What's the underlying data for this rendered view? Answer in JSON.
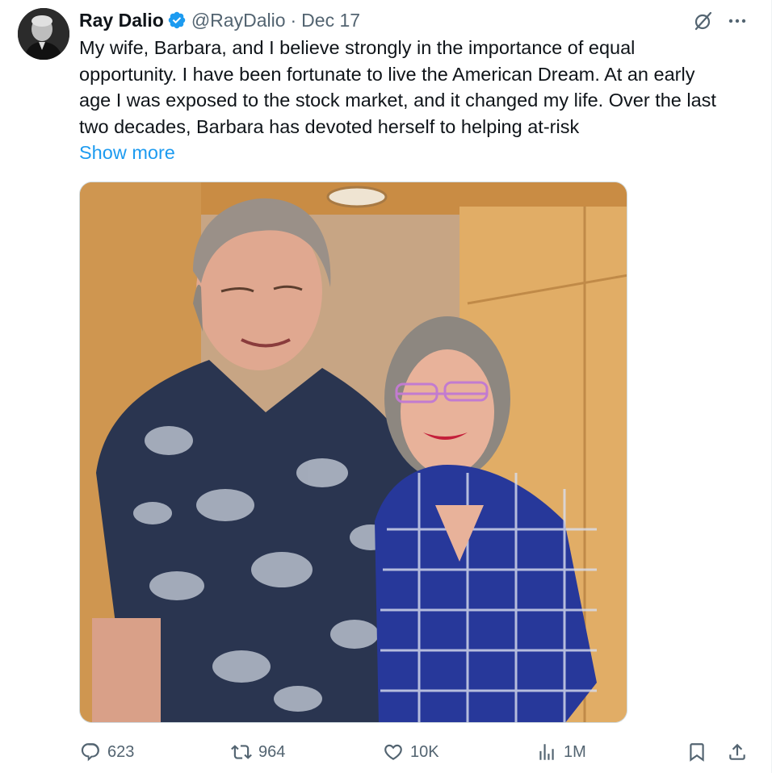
{
  "tweet": {
    "author": {
      "name": "Ray Dalio",
      "handle": "@RayDalio",
      "separator": "·",
      "date": "Dec 17"
    },
    "text": "My wife, Barbara, and I believe strongly in the importance of equal\nopportunity. I have been fortunate to live the American Dream. At an early\nage I was exposed to the stock market, and it changed my life. Over the last\ntwo decades, Barbara has devoted herself to helping at-risk",
    "show_more": "Show more",
    "icons": {
      "verified": "verified-badge-icon",
      "grok": "grok-icon",
      "more": "more-options-icon"
    },
    "colors": {
      "accent": "#1d9bf0",
      "secondary_text": "#536471",
      "primary_text": "#0f1419"
    }
  },
  "actions": {
    "replies": {
      "icon": "reply-icon",
      "count": "623"
    },
    "reposts": {
      "icon": "repost-icon",
      "count": "964"
    },
    "likes": {
      "icon": "heart-icon",
      "count": "10K"
    },
    "views": {
      "icon": "views-icon",
      "count": "1M"
    },
    "bookmark": {
      "icon": "bookmark-icon"
    },
    "share": {
      "icon": "share-icon"
    }
  }
}
